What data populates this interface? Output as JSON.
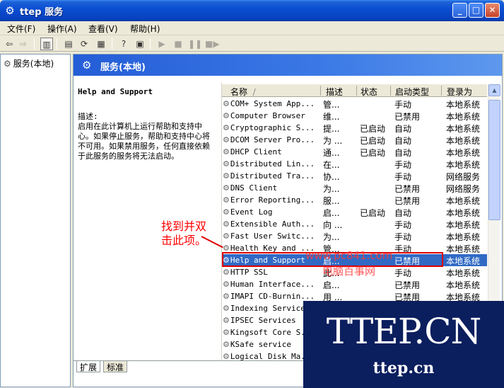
{
  "window": {
    "title": "服务",
    "title_overlay": "ttep",
    "controls": {
      "minimize": "_",
      "maximize": "□",
      "close": "✕"
    }
  },
  "menu": [
    "文件(F)",
    "操作(A)",
    "查看(V)",
    "帮助(H)"
  ],
  "toolbar": {
    "icons": [
      "back-arrow-icon",
      "forward-arrow-icon",
      "show-hide-tree-icon",
      "properties-icon",
      "refresh-icon",
      "export-list-icon",
      "help-icon",
      "console-icon",
      "start-service-icon",
      "stop-service-icon",
      "pause-service-icon",
      "restart-service-icon"
    ]
  },
  "tree": {
    "root_label": "服务(本地)"
  },
  "panel": {
    "header_title": "服务(本地)",
    "selected_name": "Help and Support",
    "description_label": "描述:",
    "description_text": "启用在此计算机上运行帮助和支持中心。如果停止服务，帮助和支持中心将不可用。如果禁用服务，任何直接依赖于此服务的服务将无法启动。"
  },
  "list": {
    "columns": {
      "name": "名称",
      "sort_indicator": "/",
      "description": "描述",
      "status": "状态",
      "startup": "启动类型",
      "logon": "登录为"
    },
    "rows": [
      {
        "name": "COM+ System App...",
        "description": "管...",
        "status": "",
        "startup": "手动",
        "logon": "本地系统"
      },
      {
        "name": "Computer Browser",
        "description": "维...",
        "status": "",
        "startup": "已禁用",
        "logon": "本地系统"
      },
      {
        "name": "Cryptographic S...",
        "description": "提...",
        "status": "已启动",
        "startup": "自动",
        "logon": "本地系统"
      },
      {
        "name": "DCOM Server Pro...",
        "description": "为 ...",
        "status": "已启动",
        "startup": "自动",
        "logon": "本地系统"
      },
      {
        "name": "DHCP Client",
        "description": "通...",
        "status": "已启动",
        "startup": "自动",
        "logon": "本地系统"
      },
      {
        "name": "Distributed Lin...",
        "description": "在...",
        "status": "",
        "startup": "手动",
        "logon": "本地系统"
      },
      {
        "name": "Distributed Tra...",
        "description": "协...",
        "status": "",
        "startup": "手动",
        "logon": "网络服务"
      },
      {
        "name": "DNS Client",
        "description": "为...",
        "status": "",
        "startup": "已禁用",
        "logon": "网络服务"
      },
      {
        "name": "Error Reporting...",
        "description": "服...",
        "status": "",
        "startup": "已禁用",
        "logon": "本地系统"
      },
      {
        "name": "Event Log",
        "description": "启...",
        "status": "已启动",
        "startup": "自动",
        "logon": "本地系统"
      },
      {
        "name": "Extensible Auth...",
        "description": "向 ...",
        "status": "",
        "startup": "手动",
        "logon": "本地系统"
      },
      {
        "name": "Fast User Switc...",
        "description": "为...",
        "status": "",
        "startup": "手动",
        "logon": "本地系统"
      },
      {
        "name": "Health Key and ...",
        "description": "管...",
        "status": "",
        "startup": "手动",
        "logon": "本地系统"
      },
      {
        "name": "Help and Support",
        "description": "启...",
        "status": "",
        "startup": "已禁用",
        "logon": "本地系统",
        "selected": true
      },
      {
        "name": "HTTP SSL",
        "description": "此...",
        "status": "",
        "startup": "手动",
        "logon": "本地系统"
      },
      {
        "name": "Human Interface...",
        "description": "启...",
        "status": "",
        "startup": "已禁用",
        "logon": "本地系统"
      },
      {
        "name": "IMAPI CD-Burnin...",
        "description": "用 ...",
        "status": "",
        "startup": "已禁用",
        "logon": "本地系统"
      },
      {
        "name": "Indexing Service",
        "description": "",
        "status": "",
        "startup": "",
        "logon": ""
      },
      {
        "name": "IPSEC Services",
        "description": "",
        "status": "",
        "startup": "",
        "logon": ""
      },
      {
        "name": "Kingsoft Core S...",
        "description": "",
        "status": "",
        "startup": "",
        "logon": ""
      },
      {
        "name": "KSafe service",
        "description": "",
        "status": "",
        "startup": "",
        "logon": ""
      },
      {
        "name": "Logical Disk Ma...",
        "description": "",
        "status": "",
        "startup": "",
        "logon": ""
      }
    ]
  },
  "tabs": [
    "扩展",
    "标准"
  ],
  "annotation": {
    "line1": "找到并双",
    "line2": "击此项。",
    "watermark_url": "www.pc841.com",
    "watermark_cn": "电脑百事网"
  },
  "overlay": {
    "logo_big": "TTEP.CN",
    "logo_small": "ttep.cn"
  },
  "colors": {
    "title_blue": "#0a4ed2",
    "selection": "#316ac5",
    "annotation_red": "#e00000",
    "overlay_navy": "#0b1e5e"
  }
}
